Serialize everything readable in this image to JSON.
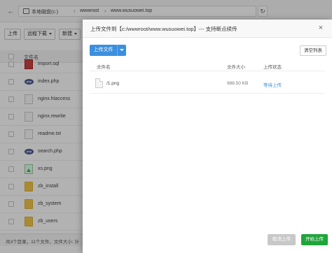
{
  "address_bar": {
    "segments": [
      "本地磁盘(c:)",
      "wwwroot",
      "www.wusuowei.top"
    ]
  },
  "toolbar": {
    "upload_label": "上传",
    "remote_download_label": "远程下载",
    "new_label": "新建"
  },
  "file_list": {
    "column_name": "文件名",
    "rows": [
      {
        "name": "import.sql",
        "icon": "sql-file-icon"
      },
      {
        "name": "index.php",
        "icon": "php-file-icon"
      },
      {
        "name": "nginx.htaccess",
        "icon": "text-file-icon"
      },
      {
        "name": "nginx.rewrite",
        "icon": "text-file-icon"
      },
      {
        "name": "readme.txt",
        "icon": "text-file-icon"
      },
      {
        "name": "search.php",
        "icon": "php-file-icon"
      },
      {
        "name": "xs.png",
        "icon": "image-file-icon"
      },
      {
        "name": "zb_install",
        "icon": "folder-icon"
      },
      {
        "name": "zb_system",
        "icon": "folder-icon"
      },
      {
        "name": "zb_users",
        "icon": "folder-icon"
      }
    ]
  },
  "status_bar": {
    "text": "共3个目录，11个文件，文件大小: 计"
  },
  "dialog": {
    "title": "上传文件到【c:/wwwroot/www.wusuowei.top】--- 支持断点续传",
    "upload_button": "上传文件",
    "clear_button": "清空列表",
    "columns": {
      "name": "文件名",
      "size": "文件大小",
      "status": "上传状态"
    },
    "files": [
      {
        "name": "/1.png",
        "size": "988.50 KB",
        "status": "等待上传"
      }
    ],
    "cancel_button": "取消上传",
    "start_button": "开始上传"
  },
  "colors": {
    "primary": "#3b8fdf",
    "success": "#20a53a",
    "muted": "#c8c8c8"
  }
}
